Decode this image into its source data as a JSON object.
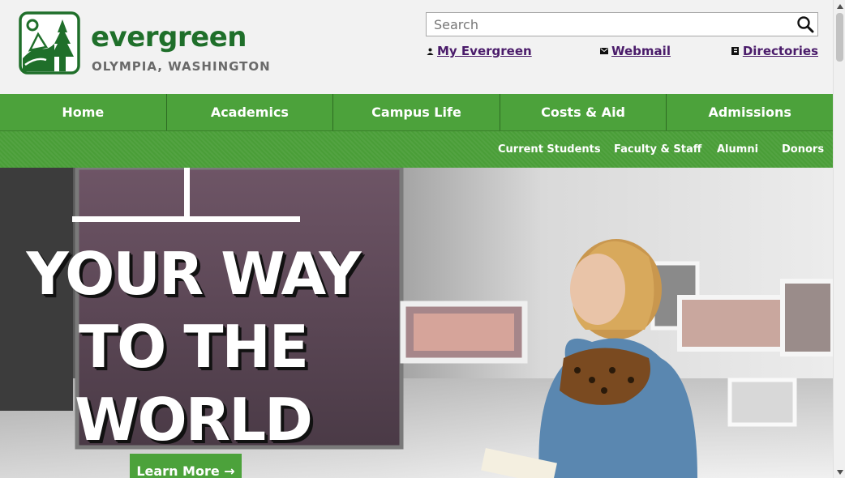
{
  "header": {
    "logo": {
      "wordmark": "evergreen",
      "location": "OLYMPIA, WASHINGTON",
      "icon": "evergreen-tree-icon",
      "color": "#1f6f2a"
    },
    "search": {
      "placeholder": "Search",
      "icon": "search-icon"
    },
    "utility_links": [
      {
        "label": "My Evergreen",
        "icon": "person-icon"
      },
      {
        "label": "Webmail",
        "icon": "envelope-icon"
      },
      {
        "label": "Directories",
        "icon": "book-icon"
      }
    ]
  },
  "main_nav": [
    {
      "label": "Home"
    },
    {
      "label": "Academics"
    },
    {
      "label": "Campus Life"
    },
    {
      "label": "Costs & Aid"
    },
    {
      "label": "Admissions"
    }
  ],
  "sub_nav": [
    {
      "label": "Current Students"
    },
    {
      "label": "Faculty & Staff"
    },
    {
      "label": "Alumni"
    },
    {
      "label": "Donors"
    }
  ],
  "hero": {
    "title_lines": [
      "YOUR WAY",
      "TO THE",
      "WORLD"
    ],
    "cta_label": "Learn More →"
  },
  "colors": {
    "brand_green": "#4ca23b",
    "link_purple": "#4a1b6a"
  }
}
